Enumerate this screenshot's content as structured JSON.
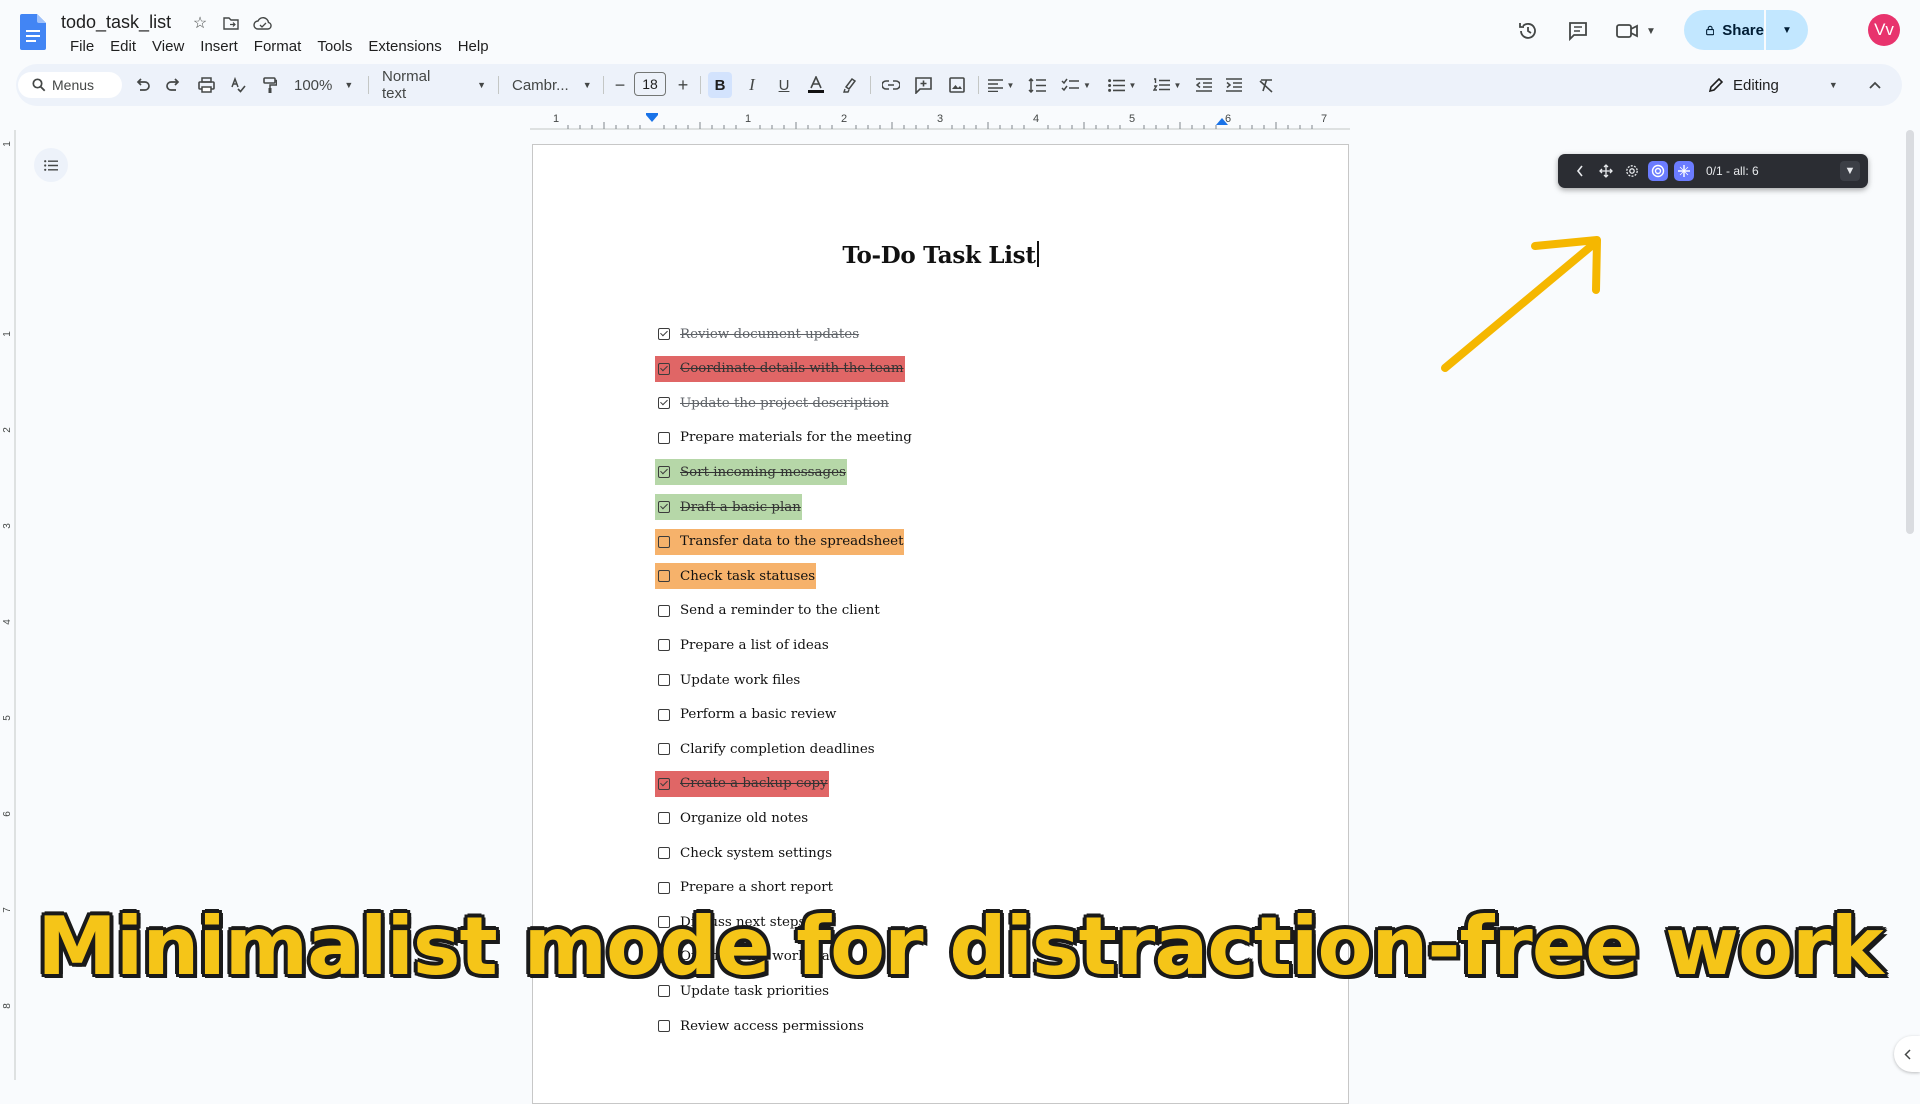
{
  "app": {
    "doc_title": "todo_task_list",
    "menu": [
      "File",
      "Edit",
      "View",
      "Insert",
      "Format",
      "Tools",
      "Extensions",
      "Help"
    ],
    "share_label": "Share",
    "avatar_initials": "Vv",
    "accent_color": "#c2e7ff",
    "avatar_color": "#e8336d"
  },
  "toolbar": {
    "search_label": "Menus",
    "zoom": "100%",
    "style": "Normal text",
    "font": "Cambr...",
    "font_size": "18",
    "mode": "Editing"
  },
  "ruler": {
    "labels": [
      "1",
      "1",
      "2",
      "3",
      "4",
      "5",
      "6",
      "7"
    ],
    "side_labels": [
      "1",
      "1",
      "2",
      "3",
      "4",
      "5",
      "6",
      "7",
      "8"
    ]
  },
  "document": {
    "heading": "To-Do Task List",
    "tasks": [
      {
        "label": "Review document updates",
        "checked": true,
        "highlight": ""
      },
      {
        "label": "Coordinate details with the team",
        "checked": true,
        "highlight": "#e06666"
      },
      {
        "label": "Update the project description",
        "checked": true,
        "highlight": ""
      },
      {
        "label": "Prepare materials for the meeting",
        "checked": false,
        "highlight": ""
      },
      {
        "label": "Sort incoming messages",
        "checked": true,
        "highlight": "#b6d7a8"
      },
      {
        "label": "Draft a basic plan",
        "checked": true,
        "highlight": "#b6d7a8"
      },
      {
        "label": "Transfer data to the spreadsheet",
        "checked": false,
        "highlight": "#f6b26b"
      },
      {
        "label": "Check task statuses",
        "checked": false,
        "highlight": "#f6b26b"
      },
      {
        "label": "Send a reminder to the client",
        "checked": false,
        "highlight": ""
      },
      {
        "label": "Prepare a list of ideas",
        "checked": false,
        "highlight": ""
      },
      {
        "label": "Update work files",
        "checked": false,
        "highlight": ""
      },
      {
        "label": "Perform a basic review",
        "checked": false,
        "highlight": ""
      },
      {
        "label": "Clarify completion deadlines",
        "checked": false,
        "highlight": ""
      },
      {
        "label": "Create a backup copy",
        "checked": true,
        "highlight": "#e06666"
      },
      {
        "label": "Organize old notes",
        "checked": false,
        "highlight": ""
      },
      {
        "label": "Check system settings",
        "checked": false,
        "highlight": ""
      },
      {
        "label": "Prepare a short report",
        "checked": false,
        "highlight": ""
      },
      {
        "label": "Discuss next steps",
        "checked": false,
        "highlight": ""
      },
      {
        "label": "Organize the workspace",
        "checked": false,
        "highlight": ""
      },
      {
        "label": "Update task priorities",
        "checked": false,
        "highlight": ""
      },
      {
        "label": "Review access permissions",
        "checked": false,
        "highlight": ""
      }
    ]
  },
  "extension": {
    "status": "0/1  -  all: 6"
  },
  "caption": {
    "text": "Minimalist mode for distraction-free work",
    "color": "#f5c518"
  },
  "arrow_color": "#f5b700"
}
